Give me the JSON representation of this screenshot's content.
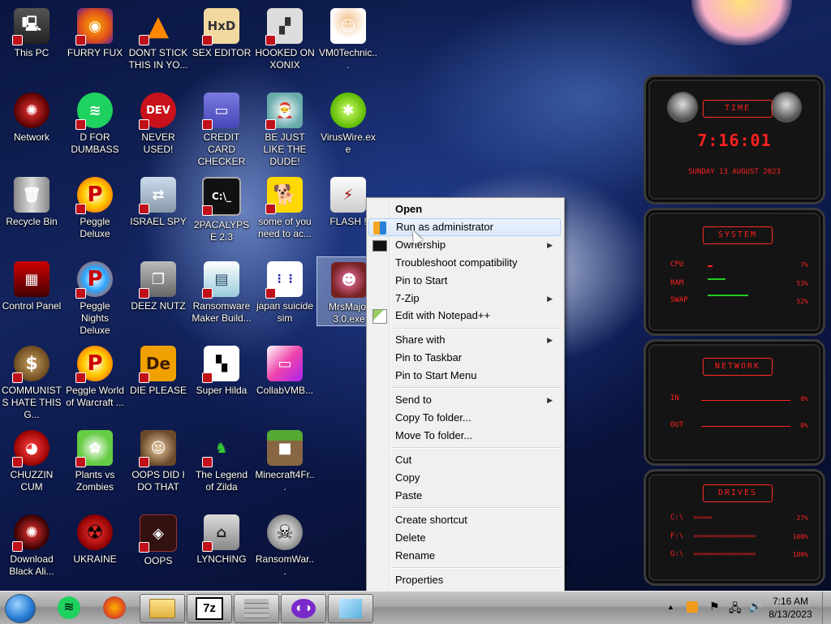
{
  "desktop_icons": [
    {
      "label": "This PC"
    },
    {
      "label": "FURRY FUX"
    },
    {
      "label": "DONT STICK THIS IN YO..."
    },
    {
      "label": "SEX EDITOR"
    },
    {
      "label": "HOOKED ON XONIX"
    },
    {
      "label": "VM0Technic..."
    },
    {
      "label": "Network"
    },
    {
      "label": "D FOR DUMBASS"
    },
    {
      "label": "NEVER USED!"
    },
    {
      "label": "CREDIT CARD CHECKER"
    },
    {
      "label": "BE JUST LIKE THE DUDE!"
    },
    {
      "label": "VirusWire.exe"
    },
    {
      "label": "Recycle Bin"
    },
    {
      "label": "Peggle Deluxe"
    },
    {
      "label": "ISRAEL SPY"
    },
    {
      "label": "2PACALYPSE 2.3"
    },
    {
      "label": "some of you need to ac..."
    },
    {
      "label": "FLASH !"
    },
    {
      "label": "Control Panel"
    },
    {
      "label": "Peggle Nights Deluxe"
    },
    {
      "label": "DEEZ NUTZ"
    },
    {
      "label": "Ransomware Maker Build..."
    },
    {
      "label": "japan suicide sim"
    },
    {
      "label": "MrsMajor 3.0.exe"
    },
    {
      "label": "COMMUNISTS HATE THIS G..."
    },
    {
      "label": "Peggle World of Warcraft ..."
    },
    {
      "label": "DIE PLEASE"
    },
    {
      "label": "Super Hilda"
    },
    {
      "label": "CollabVMB..."
    },
    {
      "label": "CHUZZIN CUM"
    },
    {
      "label": "Plants vs Zombies"
    },
    {
      "label": "OOPS DID I DO THAT"
    },
    {
      "label": "The Legend of Zilda"
    },
    {
      "label": "Minecraft4Fr..."
    },
    {
      "label": "Download Black Ali..."
    },
    {
      "label": "UKRAINE"
    },
    {
      "label": "OOPS"
    },
    {
      "label": "LYNCHING"
    },
    {
      "label": "RansomWar..."
    }
  ],
  "context_menu": {
    "items": [
      {
        "label": "Open"
      },
      {
        "label": "Run as administrator"
      },
      {
        "label": "Ownership"
      },
      {
        "label": "Troubleshoot compatibility"
      },
      {
        "label": "Pin to Start"
      },
      {
        "label": "7-Zip"
      },
      {
        "label": "Edit with Notepad++"
      },
      {
        "label": "Share with"
      },
      {
        "label": "Pin to Taskbar"
      },
      {
        "label": "Pin to Start Menu"
      },
      {
        "label": "Send to"
      },
      {
        "label": "Copy To folder..."
      },
      {
        "label": "Move To folder..."
      },
      {
        "label": "Cut"
      },
      {
        "label": "Copy"
      },
      {
        "label": "Paste"
      },
      {
        "label": "Create shortcut"
      },
      {
        "label": "Delete"
      },
      {
        "label": "Rename"
      },
      {
        "label": "Properties"
      }
    ]
  },
  "gadget": {
    "time_title": "TIME",
    "time": "7:16:01",
    "date": "SUNDAY 13 AUGUST 2023",
    "system_title": "SYSTEM",
    "cpu_label": "CPU",
    "cpu_val": "7%",
    "ram_label": "RAM",
    "ram_val": "53%",
    "swap_label": "SWAP",
    "swap_val": "52%",
    "network_title": "NETWORK",
    "in_label": "IN",
    "in_val": "0%",
    "out_label": "OUT",
    "out_val": "0%",
    "drives_title": "DRIVES",
    "c_label": "C:\\",
    "c_val": "27%",
    "f_label": "F:\\",
    "f_val": "100%",
    "g_label": "G:\\",
    "g_val": "100%"
  },
  "taskbar": {
    "time": "7:16 AM",
    "date": "8/13/2023",
    "zip_label": "7z"
  }
}
